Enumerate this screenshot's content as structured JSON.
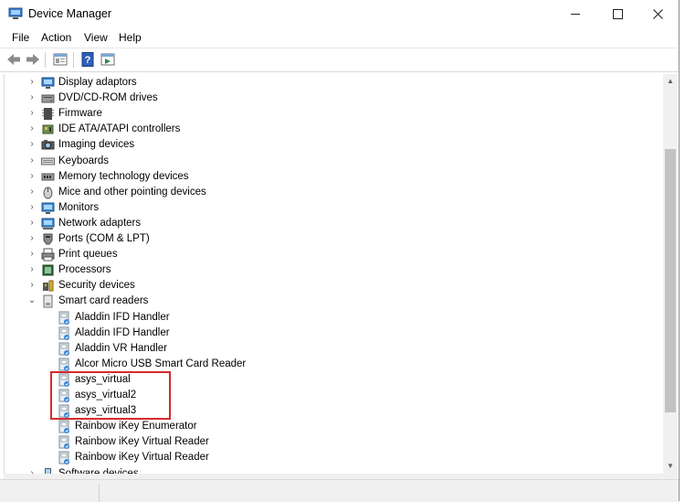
{
  "window": {
    "title": "Device Manager"
  },
  "menu": [
    "File",
    "Action",
    "View",
    "Help"
  ],
  "toolbar": [
    "back-icon",
    "forward-icon",
    "properties-icon",
    "help-icon",
    "update-icon"
  ],
  "tree": {
    "items": [
      {
        "label": "Display adaptors",
        "icon": "display-adapter-icon"
      },
      {
        "label": "DVD/CD-ROM drives",
        "icon": "dvd-drive-icon"
      },
      {
        "label": "Firmware",
        "icon": "firmware-icon"
      },
      {
        "label": "IDE ATA/ATAPI controllers",
        "icon": "ide-controller-icon"
      },
      {
        "label": "Imaging devices",
        "icon": "camera-icon"
      },
      {
        "label": "Keyboards",
        "icon": "keyboard-icon"
      },
      {
        "label": "Memory technology devices",
        "icon": "memory-icon"
      },
      {
        "label": "Mice and other pointing devices",
        "icon": "mouse-icon"
      },
      {
        "label": "Monitors",
        "icon": "monitor-icon"
      },
      {
        "label": "Network adapters",
        "icon": "network-adapter-icon"
      },
      {
        "label": "Ports (COM & LPT)",
        "icon": "port-icon"
      },
      {
        "label": "Print queues",
        "icon": "printer-icon"
      },
      {
        "label": "Processors",
        "icon": "processor-icon"
      },
      {
        "label": "Security devices",
        "icon": "security-device-icon"
      },
      {
        "label": "Smart card readers",
        "icon": "smartcard-reader-icon",
        "expanded": true
      },
      {
        "label": "Aladdin IFD Handler",
        "icon": "device-icon",
        "child": true
      },
      {
        "label": "Aladdin IFD Handler",
        "icon": "device-icon",
        "child": true
      },
      {
        "label": "Aladdin VR Handler",
        "icon": "device-icon",
        "child": true
      },
      {
        "label": "Alcor Micro USB Smart Card Reader",
        "icon": "device-icon",
        "child": true
      },
      {
        "label": "asys_virtual",
        "icon": "device-icon",
        "child": true
      },
      {
        "label": "asys_virtual2",
        "icon": "device-icon",
        "child": true
      },
      {
        "label": "asys_virtual3",
        "icon": "device-icon",
        "child": true
      },
      {
        "label": "Rainbow iKey Enumerator",
        "icon": "device-icon",
        "child": true
      },
      {
        "label": "Rainbow iKey Virtual Reader",
        "icon": "device-icon",
        "child": true
      },
      {
        "label": "Rainbow iKey Virtual Reader",
        "icon": "device-icon",
        "child": true
      },
      {
        "label": "Software devices",
        "icon": "software-device-icon"
      }
    ]
  },
  "colors": {
    "highlight_border": "#d52b2b",
    "folder_blue": "#2f7fd6"
  }
}
